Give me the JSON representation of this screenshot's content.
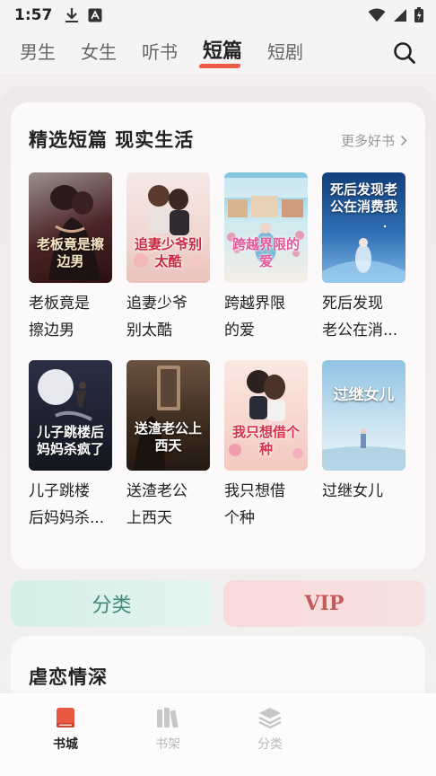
{
  "status_bar": {
    "time": "1:57"
  },
  "tabs": [
    {
      "label": "男生"
    },
    {
      "label": "女生"
    },
    {
      "label": "听书"
    },
    {
      "label": "短篇"
    },
    {
      "label": "短剧"
    }
  ],
  "active_tab": "短篇",
  "section": {
    "title": "精选短篇 现实生活",
    "more_label": "更多好书"
  },
  "books": [
    {
      "name": "老板竟是擦边男",
      "display": "老板竟是\n擦边男",
      "cover_text": "老板竟是擦边男",
      "cover_color": "#5a2a2a"
    },
    {
      "name": "追妻少爷别太酷",
      "display": "追妻少爷\n别太酷",
      "cover_text": "追妻少爷别太酷",
      "cover_color": "#f3d7d2"
    },
    {
      "name": "跨越界限的爱",
      "display": "跨越界限\n的爱",
      "cover_text": "跨越界限的爱",
      "cover_color": "#a9d6e6"
    },
    {
      "name": "死后发现老公在消费我",
      "display": "死后发现\n老公在消...",
      "cover_text": "死后发现老公在消费我",
      "cover_color": "#1d4f86"
    },
    {
      "name": "儿子跳楼后妈妈杀疯了",
      "display": "儿子跳楼\n后妈妈杀...",
      "cover_text": "儿子跳楼后妈妈杀疯了",
      "cover_color": "#1c2030"
    },
    {
      "name": "送渣老公上西天",
      "display": "送渣老公\n上西天",
      "cover_text": "送渣老公上西天",
      "cover_color": "#3b2a1e"
    },
    {
      "name": "我只想借个种",
      "display": "我只想借\n个种",
      "cover_text": "我只想借个种",
      "cover_color": "#f0c4b8"
    },
    {
      "name": "过继女儿",
      "display": "过继女儿",
      "cover_text": "过继女儿",
      "cover_color": "#a9cfe8"
    }
  ],
  "quick_buttons": {
    "category": "分类",
    "vip": "VIP"
  },
  "section2": {
    "title": "虐恋情深"
  },
  "bottom_nav": [
    {
      "label": "书城",
      "icon": "book-icon",
      "active": true
    },
    {
      "label": "书架",
      "icon": "shelf-icon",
      "active": false
    },
    {
      "label": "分类",
      "icon": "layers-icon",
      "active": false
    }
  ],
  "colors": {
    "accent": "#ec5b45",
    "background": "#f3efef",
    "card": "#fbf9f9"
  }
}
